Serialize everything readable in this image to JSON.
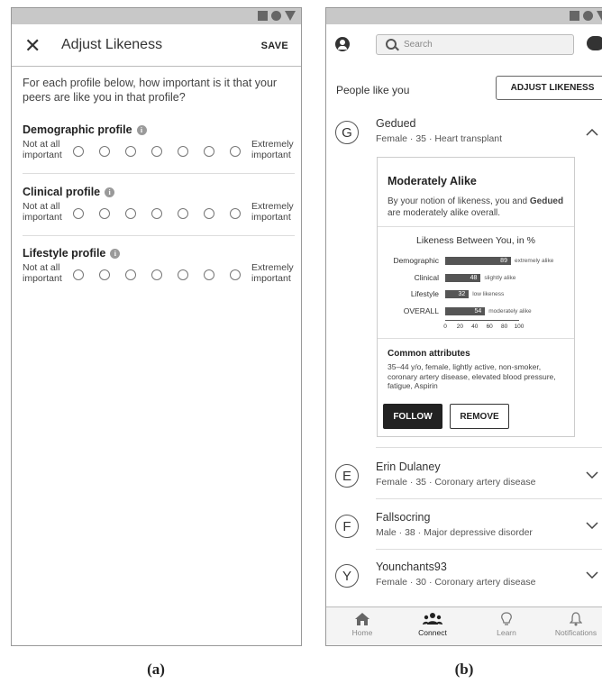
{
  "captions": {
    "a": "(a)",
    "b": "(b)"
  },
  "panel_a": {
    "title": "Adjust Likeness",
    "save_label": "SAVE",
    "intro": "For each profile below, how important is it that your peers are like you in that profile?",
    "scale_low": "Not at all important",
    "scale_high": "Extremely important",
    "profiles": [
      {
        "label": "Demographic profile"
      },
      {
        "label": "Clinical profile"
      },
      {
        "label": "Lifestyle profile"
      }
    ]
  },
  "panel_b": {
    "search_placeholder": "Search",
    "section_title": "People like you",
    "adjust_label": "ADJUST LIKENESS",
    "people": [
      {
        "initial": "G",
        "name": "Gedued",
        "desc": "Female · 35 · Heart transplant"
      },
      {
        "initial": "E",
        "name": "Erin Dulaney",
        "desc": "Female · 35 · Coronary artery disease"
      },
      {
        "initial": "F",
        "name": "Fallsocring",
        "desc": "Male · 38 · Major depressive disorder"
      },
      {
        "initial": "Y",
        "name": "Younchants93",
        "desc": "Female · 30 · Coronary artery disease"
      }
    ],
    "card": {
      "title": "Moderately Alike",
      "text_before": "By your notion of likeness, you and ",
      "text_bold": "Gedued",
      "text_after": " are moderately alike overall.",
      "common_title": "Common attributes",
      "common_text": "35–44 y/o, female, lightly active, non-smoker, coronary artery disease, elevated blood pressure, fatigue, Aspirin",
      "follow_label": "FOLLOW",
      "remove_label": "REMOVE"
    },
    "nav": [
      {
        "label": "Home",
        "icon": "home-icon"
      },
      {
        "label": "Connect",
        "icon": "people-icon"
      },
      {
        "label": "Learn",
        "icon": "lightbulb-icon"
      },
      {
        "label": "Notifications",
        "icon": "bell-icon"
      }
    ]
  },
  "chart_data": {
    "type": "bar",
    "title": "Likeness Between You, in %",
    "categories": [
      "Demographic",
      "Clinical",
      "Lifestyle",
      "OVERALL"
    ],
    "values": [
      89,
      48,
      32,
      54
    ],
    "annotations": [
      "extremely alike",
      "slightly alike",
      "low likeness",
      "moderately alike"
    ],
    "xlim": [
      0,
      100
    ],
    "xticks": [
      "0",
      "20",
      "40",
      "60",
      "80",
      "100"
    ]
  }
}
